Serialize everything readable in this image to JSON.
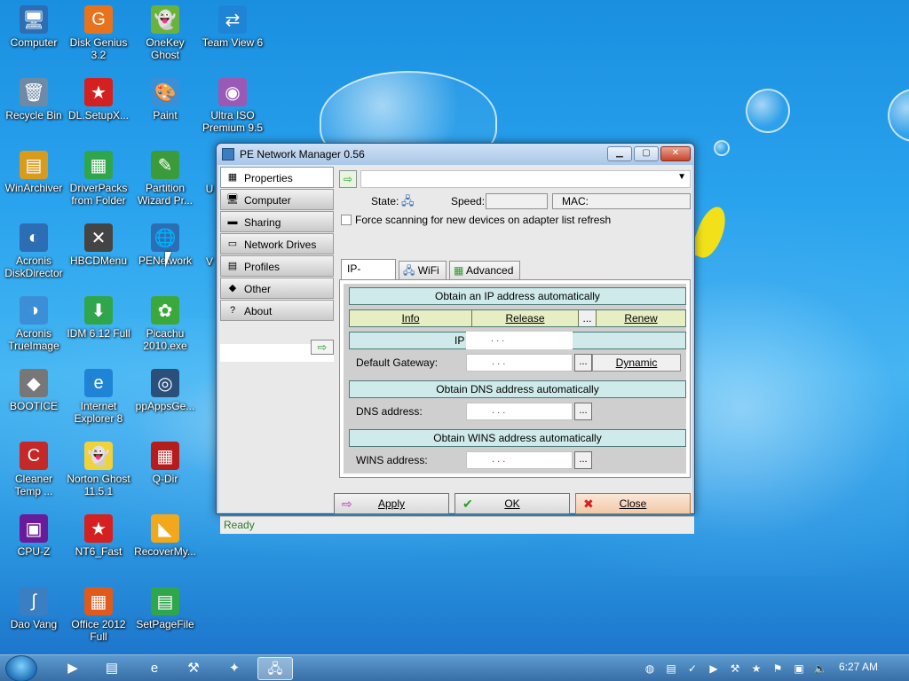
{
  "desktop": {
    "icons": [
      {
        "label": "Computer",
        "glyph": "🖥",
        "color": "#2d6db3"
      },
      {
        "label": "Disk Genius 3.2",
        "glyph": "G",
        "color": "#e8731c"
      },
      {
        "label": "OneKey Ghost",
        "glyph": "👻",
        "color": "#6ab33a"
      },
      {
        "label": "Team View 6",
        "glyph": "⇄",
        "color": "#1f84d6"
      },
      {
        "label": "Recycle Bin",
        "glyph": "🗑",
        "color": "#6e8aa6"
      },
      {
        "label": "DL.SetupX...",
        "glyph": "★",
        "color": "#d42020"
      },
      {
        "label": "Paint",
        "glyph": "🎨",
        "color": "#3b8fd6"
      },
      {
        "label": "Ultra ISO Premium 9.5",
        "glyph": "◉",
        "color": "#9b59b6"
      },
      {
        "label": "WinArchiver",
        "glyph": "▤",
        "color": "#d99b1c"
      },
      {
        "label": "DriverPacks from Folder",
        "glyph": "▦",
        "color": "#2fa64b"
      },
      {
        "label": "Partition Wizard Pr...",
        "glyph": "✎",
        "color": "#3b9b3b"
      },
      {
        "label": "Acronis DiskDirector",
        "glyph": "◐",
        "color": "#2d6db3"
      },
      {
        "label": "HBCDMenu",
        "glyph": "✕",
        "color": "#444444"
      },
      {
        "label": "PENetwork",
        "glyph": "🌐",
        "color": "#2d6db3"
      },
      {
        "label": "Acronis TrueImage",
        "glyph": "◑",
        "color": "#3c8fd6"
      },
      {
        "label": "IDM 6.12 Full",
        "glyph": "⬇",
        "color": "#2fa64b"
      },
      {
        "label": "Picachu 2010.exe",
        "glyph": "✿",
        "color": "#3aa83a"
      },
      {
        "label": "BOOTICE",
        "glyph": "◆",
        "color": "#777777"
      },
      {
        "label": "Internet Explorer 8",
        "glyph": "e",
        "color": "#1f84d6"
      },
      {
        "label": "ppAppsGe...",
        "glyph": "◎",
        "color": "#2a4f7a"
      },
      {
        "label": "Cleaner Temp ...",
        "glyph": "C",
        "color": "#c62828"
      },
      {
        "label": "Norton Ghost 11.5.1",
        "glyph": "👻",
        "color": "#f2d23a"
      },
      {
        "label": "Q-Dir",
        "glyph": "▦",
        "color": "#b71c1c"
      },
      {
        "label": "CPU-Z",
        "glyph": "▣",
        "color": "#6a1b9a"
      },
      {
        "label": "NT6_Fast",
        "glyph": "★",
        "color": "#d42020"
      },
      {
        "label": "RecoverMy...",
        "glyph": "◣",
        "color": "#f2a81c"
      },
      {
        "label": "Dao Vang",
        "glyph": "∫",
        "color": "#3c7ec2"
      },
      {
        "label": "Office 2012 Full",
        "glyph": "▦",
        "color": "#e05a1c"
      },
      {
        "label": "SetPageFile",
        "glyph": "▤",
        "color": "#2fa64b"
      }
    ],
    "partial_label_1": "U",
    "partial_label_2": "V"
  },
  "window": {
    "title": "PE Network Manager 0.56",
    "sidebar": [
      {
        "label": "Properties",
        "icon": "properties-icon",
        "glyph": "▦"
      },
      {
        "label": "Computer",
        "icon": "computer-icon",
        "glyph": "🖥"
      },
      {
        "label": "Sharing",
        "icon": "sharing-icon",
        "glyph": "▬"
      },
      {
        "label": "Network Drives",
        "icon": "network-drive-icon",
        "glyph": "▭"
      },
      {
        "label": "Profiles",
        "icon": "profiles-icon",
        "glyph": "▤"
      },
      {
        "label": "Other",
        "icon": "other-icon",
        "glyph": "◆"
      },
      {
        "label": "About",
        "icon": "help-icon",
        "glyph": "?"
      }
    ],
    "adapter_select_value": "",
    "state_label": "State:",
    "speed_label": "Speed:",
    "speed_value": "",
    "mac_label": "MAC:",
    "mac_value": "",
    "force_scan_label": "Force scanning for new devices on adapter list refresh",
    "tabs": [
      {
        "label": "IP-Settings"
      },
      {
        "label": "WiFi"
      },
      {
        "label": "Advanced"
      }
    ],
    "ip_settings": {
      "obtain_ip": "Obtain an IP address automatically",
      "info": "Info",
      "release": "Release",
      "dots_button": "...",
      "renew": "Renew",
      "ip_label_partial": "IP a",
      "default_gateway_label": "Default Gateway:",
      "dynamic": "Dynamic",
      "obtain_dns": "Obtain DNS address automatically",
      "dns_label": "DNS address:",
      "obtain_wins": "Obtain WINS address automatically",
      "wins_label": "WINS address:",
      "ip_placeholder": ".       .       ."
    },
    "buttons": {
      "apply": "Apply",
      "ok": "OK",
      "close": "Close"
    },
    "status": "Ready"
  },
  "taskbar": {
    "clock": "6:27 AM"
  },
  "colors": {
    "ready_text": "#2b7a2b",
    "band_teal": "#cfeaea",
    "band_yellow": "#e6eec4"
  }
}
